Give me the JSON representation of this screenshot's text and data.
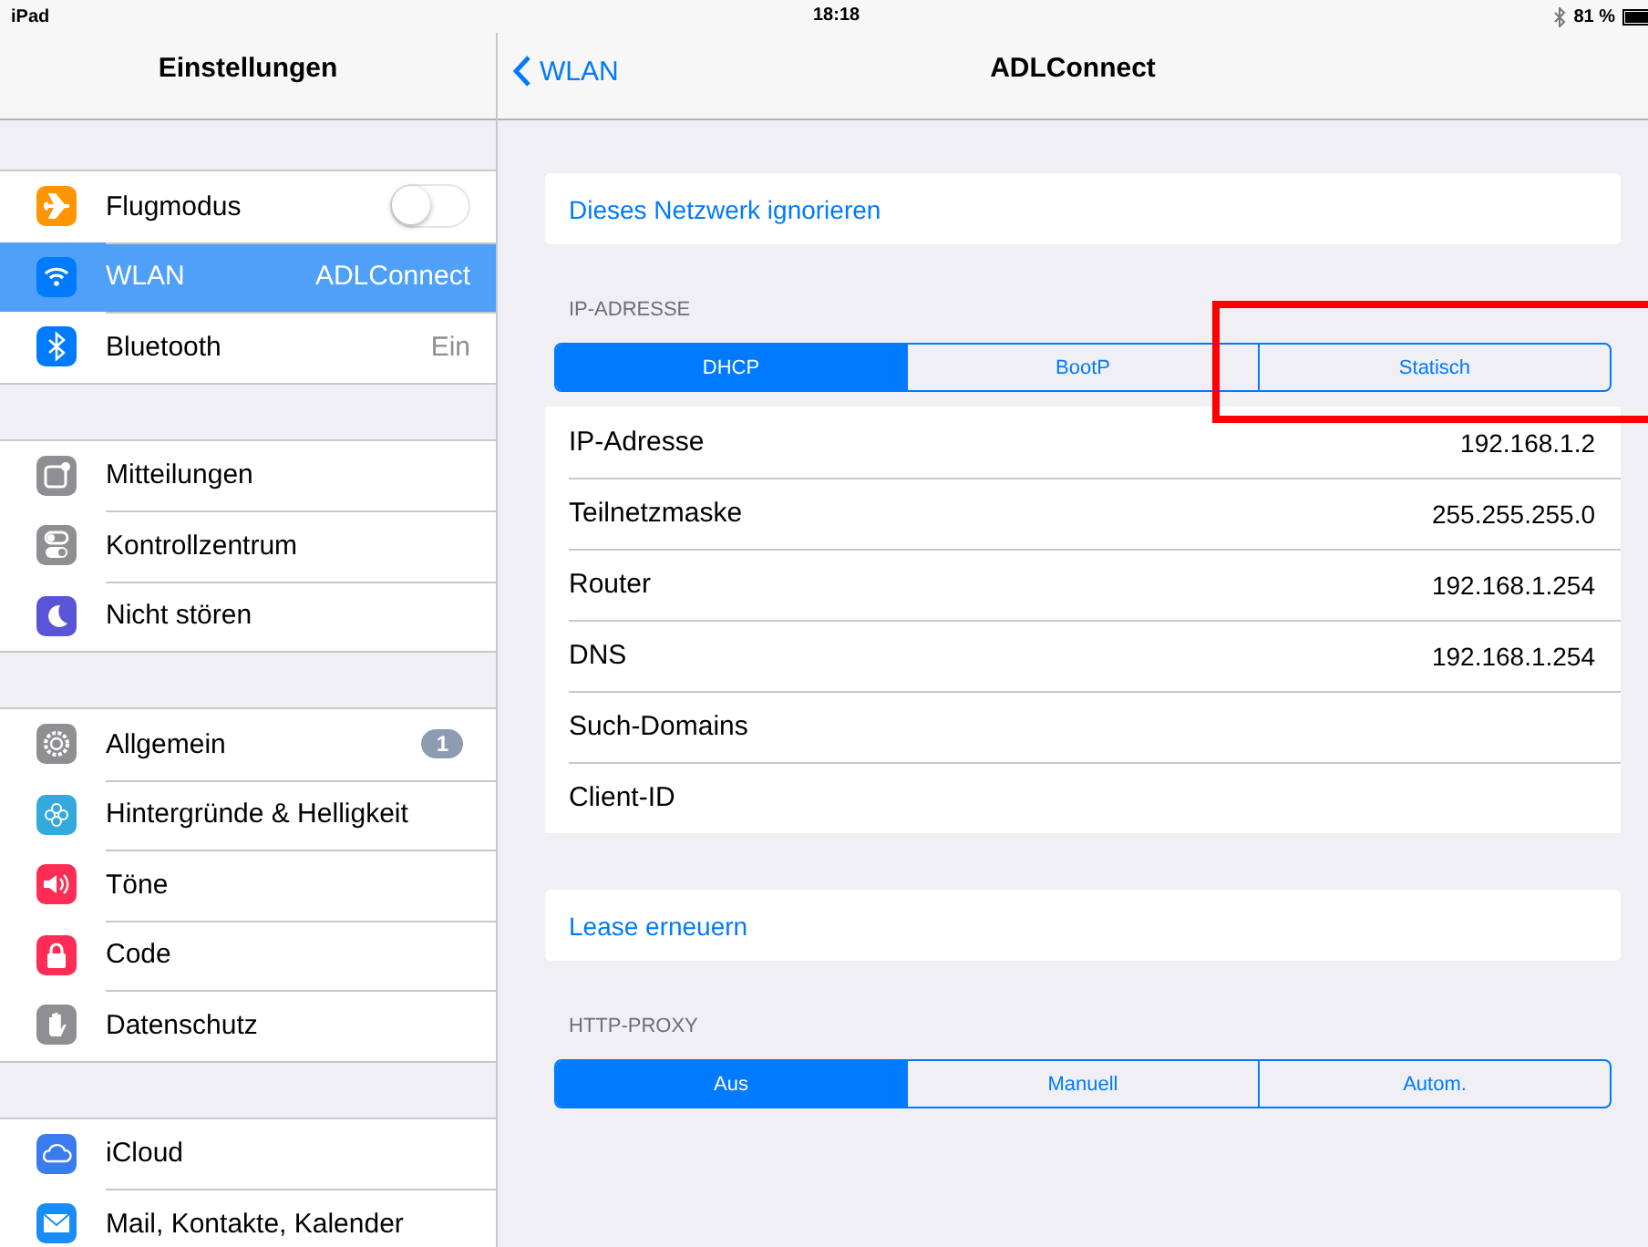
{
  "status_bar": {
    "device": "iPad",
    "time": "18:18",
    "battery": "81 %"
  },
  "sidebar": {
    "title": "Einstellungen",
    "groups": [
      [
        {
          "label": "Flugmodus",
          "kind": "toggle",
          "on": false,
          "selected": false,
          "color": "#ff9500"
        },
        {
          "label": "WLAN",
          "kind": "value",
          "value": "ADLConnect",
          "selected": true,
          "color": "#007aff"
        },
        {
          "label": "Bluetooth",
          "kind": "value",
          "value": "Ein",
          "selected": false,
          "color": "#007aff"
        }
      ],
      [
        {
          "label": "Mitteilungen",
          "kind": "plain",
          "selected": false,
          "color": "#8e8e93"
        },
        {
          "label": "Kontrollzentrum",
          "kind": "plain",
          "selected": false,
          "color": "#8e8e93"
        },
        {
          "label": "Nicht stören",
          "kind": "plain",
          "selected": false,
          "color": "#5856d6"
        }
      ],
      [
        {
          "label": "Allgemein",
          "kind": "badge",
          "badge": "1",
          "selected": false,
          "color": "#8e8e93"
        },
        {
          "label": "Hintergründe & Helligkeit",
          "kind": "plain",
          "selected": false,
          "color": "#34aadc"
        },
        {
          "label": "Töne",
          "kind": "plain",
          "selected": false,
          "color": "#ff2d55"
        },
        {
          "label": "Code",
          "kind": "plain",
          "selected": false,
          "color": "#ff2d55"
        },
        {
          "label": "Datenschutz",
          "kind": "plain",
          "selected": false,
          "color": "#8e8e93"
        }
      ],
      [
        {
          "label": "iCloud",
          "kind": "plain",
          "selected": false,
          "color": "#3a7bf0"
        },
        {
          "label": "Mail, Kontakte, Kalender",
          "kind": "plain",
          "selected": false,
          "color": "#1a8cf7"
        }
      ]
    ]
  },
  "detail": {
    "back": "WLAN",
    "title": "ADLConnect",
    "ignore_action": "Dieses Netzwerk ignorieren",
    "ip_header": "IP-ADRESSE",
    "ip_modes": [
      {
        "label": "DHCP",
        "selected": true
      },
      {
        "label": "BootP",
        "selected": false
      },
      {
        "label": "Statisch",
        "selected": false
      }
    ],
    "rows": [
      {
        "label": "IP-Adresse",
        "value": "192.168.1.2"
      },
      {
        "label": "Teilnetzmaske",
        "value": "255.255.255.0"
      },
      {
        "label": "Router",
        "value": "192.168.1.254"
      },
      {
        "label": "DNS",
        "value": "192.168.1.254"
      },
      {
        "label": "Such-Domains"
      },
      {
        "label": "Client-ID"
      }
    ],
    "lease_action": "Lease erneuern",
    "proxy_header": "HTTP-PROXY",
    "proxy_modes": [
      {
        "label": "Aus",
        "selected": true
      },
      {
        "label": "Manuell",
        "selected": false
      },
      {
        "label": "Autom.",
        "selected": false
      }
    ]
  }
}
